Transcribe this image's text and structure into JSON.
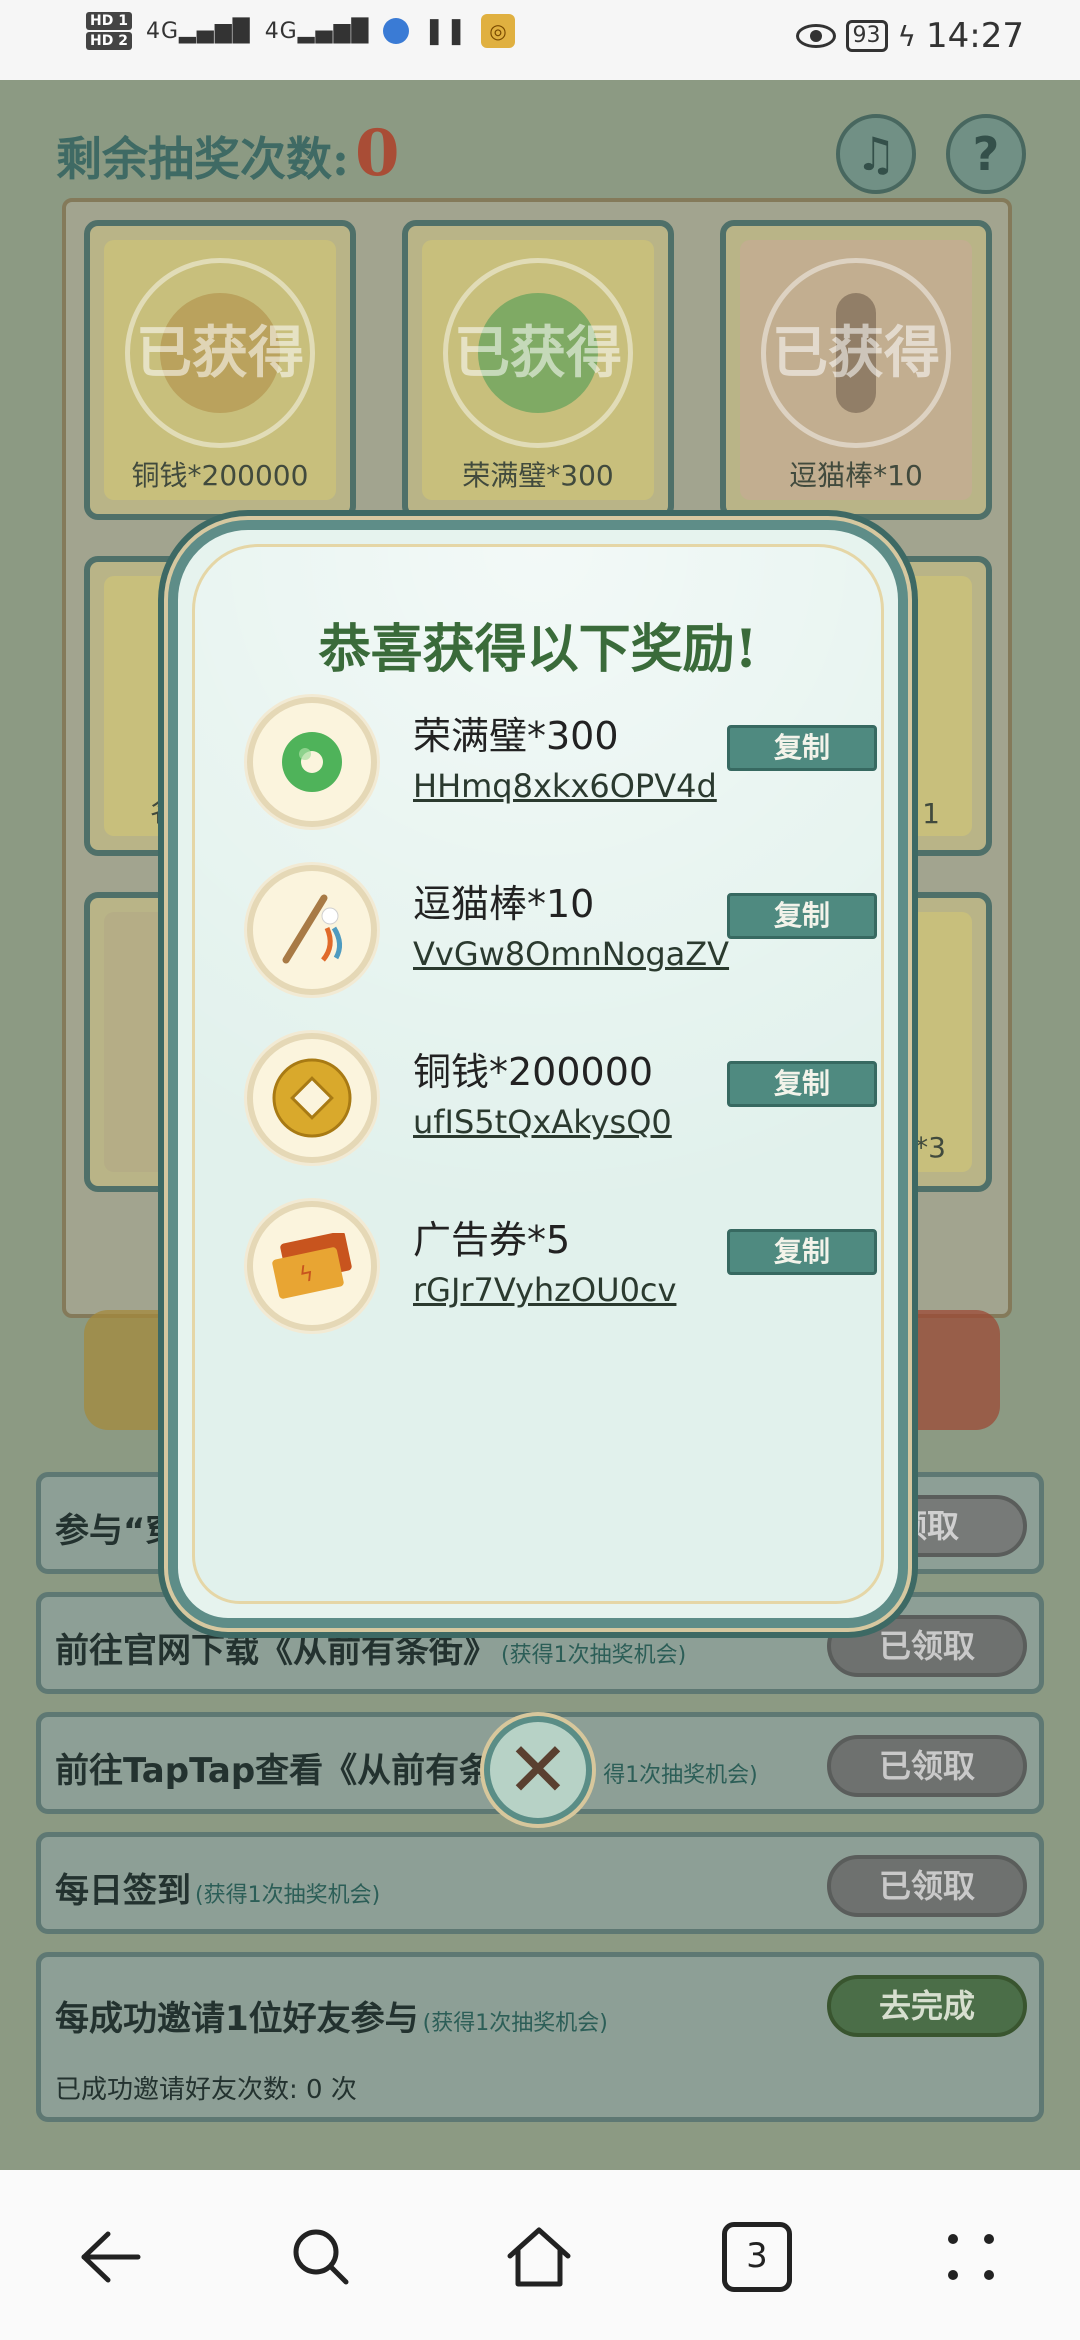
{
  "status_bar": {
    "hd1": "HD 1",
    "hd2": "HD 2",
    "signal1": "4G",
    "signal2": "4G",
    "battery": "93",
    "time": "14:27"
  },
  "header": {
    "lottery_label": "剩余抽奖次数:",
    "lottery_count": "0",
    "music_icon": "music-icon",
    "help_icon": "help-icon"
  },
  "board": {
    "stamp_text": "已获得",
    "cells": [
      {
        "label": "铜钱*200000"
      },
      {
        "label": "荣满璧*300"
      },
      {
        "label": "逗猫棒*10"
      },
      {
        "label": "名"
      },
      {
        "label": "1"
      },
      {
        "label": "才*3"
      }
    ]
  },
  "modal": {
    "title": "恭喜获得以下奖励!",
    "copy_label": "复制",
    "rewards": [
      {
        "name": "荣满璧*300",
        "code": "HHmq8xkx6OPV4d",
        "icon": "jade-disc-icon"
      },
      {
        "name": "逗猫棒*10",
        "code": "VvGw8OmnNogaZV",
        "icon": "cat-wand-icon"
      },
      {
        "name": "铜钱*200000",
        "code": "ufIS5tQxAkysQ0",
        "icon": "copper-coin-icon"
      },
      {
        "name": "广告券*5",
        "code": "rGJr7VyhzOU0cv",
        "icon": "ad-ticket-icon"
      }
    ]
  },
  "tasks": [
    {
      "title": "参与“穿",
      "note": "",
      "button": "领取"
    },
    {
      "title": "前往官网下载《从前有条街》",
      "note": "(获得1次抽奖机会)",
      "button": "已领取"
    },
    {
      "title": "前往TapTap查看《从前有条",
      "note": "得1次抽奖机会)",
      "button": "已领取"
    },
    {
      "title": "每日签到",
      "note": "(获得1次抽奖机会)",
      "button": "已领取"
    },
    {
      "title": "每成功邀请1位好友参与",
      "note": "(获得1次抽奖机会)",
      "button": "去完成",
      "sub": "已成功邀请好友次数: 0 次"
    }
  ],
  "navbar": {
    "tab_count": "3"
  },
  "colors": {
    "accent_teal": "#4f8a80",
    "title_green": "#3a6b3a",
    "number_red": "#b13a24"
  }
}
